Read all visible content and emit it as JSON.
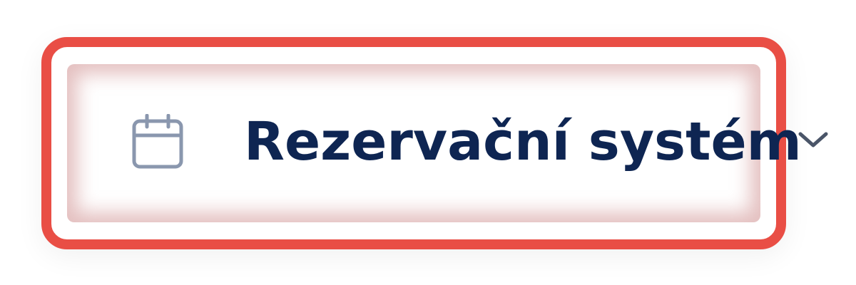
{
  "menu_item": {
    "label": "Rezervační systém",
    "icon": "calendar-icon",
    "expand_icon": "chevron-down-icon"
  },
  "colors": {
    "highlight_border": "#e94e45",
    "label_text": "#0e2552",
    "icon_stroke": "#8a97ae",
    "chevron_stroke": "#4a5568"
  }
}
